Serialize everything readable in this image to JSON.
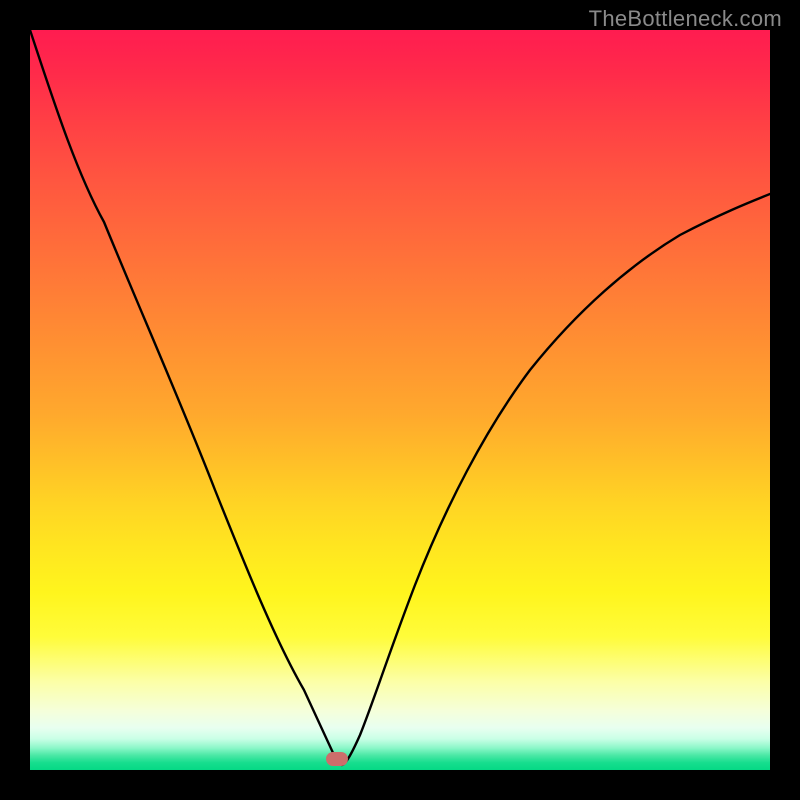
{
  "watermark": "TheBottleneck.com",
  "marker": {
    "cx_frac": 0.415,
    "cy_frac": 0.988
  },
  "chart_data": {
    "type": "line",
    "title": "",
    "xlabel": "",
    "ylabel": "",
    "xlim": [
      0,
      1
    ],
    "ylim": [
      0,
      1
    ],
    "grid": false,
    "legend": false,
    "background": "rainbow-vertical-gradient (red top → green bottom)",
    "series": [
      {
        "name": "bottleneck-curve",
        "color": "#000000",
        "x": [
          0.0,
          0.05,
          0.1,
          0.15,
          0.2,
          0.25,
          0.3,
          0.34,
          0.37,
          0.395,
          0.41,
          0.42,
          0.44,
          0.47,
          0.52,
          0.58,
          0.65,
          0.73,
          0.82,
          0.91,
          1.0
        ],
        "y": [
          1.0,
          0.87,
          0.74,
          0.61,
          0.49,
          0.37,
          0.25,
          0.15,
          0.08,
          0.03,
          0.01,
          0.01,
          0.04,
          0.12,
          0.25,
          0.38,
          0.49,
          0.59,
          0.67,
          0.73,
          0.78
        ],
        "note": "V-shaped curve with sharp minimum near x≈0.415; values are read as fraction of plot height from bottom (1.0=top, 0.0=bottom)."
      }
    ],
    "annotations": [
      {
        "type": "marker",
        "shape": "rounded-rect",
        "color": "#cc6e6b",
        "x": 0.415,
        "y": 0.012
      }
    ]
  }
}
